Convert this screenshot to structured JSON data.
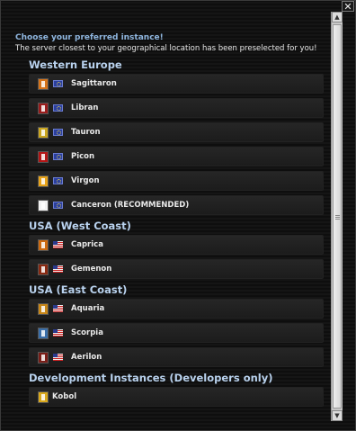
{
  "window": {
    "close_glyph": "✕"
  },
  "intro": {
    "title": "Choose your preferred instance!",
    "text": "The server closest to your geographical location has been preselected for you!"
  },
  "groups": [
    {
      "title": "Western Europe",
      "servers": [
        {
          "name": "Sagittaron",
          "flag": "eu",
          "color": "#d4731a"
        },
        {
          "name": "Libran",
          "flag": "eu",
          "color": "#9a1c1c"
        },
        {
          "name": "Tauron",
          "flag": "eu",
          "color": "#c9a520"
        },
        {
          "name": "Picon",
          "flag": "eu",
          "color": "#b31616"
        },
        {
          "name": "Virgon",
          "flag": "eu",
          "color": "#e6a21a"
        },
        {
          "name": "Canceron (RECOMMENDED)",
          "flag": "eu",
          "color": "#f2f2f2"
        }
      ]
    },
    {
      "title": "USA (West Coast)",
      "servers": [
        {
          "name": "Caprica",
          "flag": "us",
          "color": "#cc6a10"
        },
        {
          "name": "Gemenon",
          "flag": "us",
          "color": "#8a2a12"
        }
      ]
    },
    {
      "title": "USA (East Coast)",
      "servers": [
        {
          "name": "Aquaria",
          "flag": "us",
          "color": "#c78618"
        },
        {
          "name": "Scorpia",
          "flag": "us",
          "color": "#3a6ea8"
        },
        {
          "name": "Aerilon",
          "flag": "us",
          "color": "#7a1e18"
        }
      ]
    },
    {
      "title": "Development Instances (Developers only)",
      "servers": [
        {
          "name": "Kobol",
          "flag": "",
          "color": "#d9a81c"
        }
      ]
    }
  ],
  "colors": {
    "accent": "#8fb6df",
    "group_title": "#b9d2ee",
    "row_bg": "#262626"
  }
}
